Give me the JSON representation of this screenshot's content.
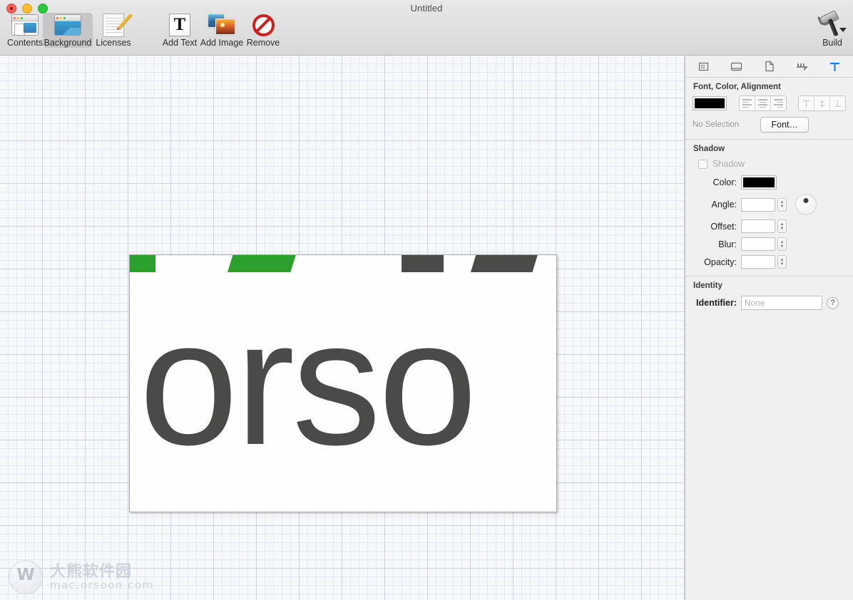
{
  "window": {
    "title": "Untitled",
    "traffic_lights": [
      "close",
      "minimize",
      "zoom"
    ]
  },
  "toolbar": {
    "items": [
      {
        "label": "Contents",
        "icon": "contents-window-icon",
        "selected": false
      },
      {
        "label": "Background",
        "icon": "background-window-icon",
        "selected": true
      },
      {
        "label": "Licenses",
        "icon": "licenses-document-icon",
        "selected": false
      },
      {
        "label": "Add Text",
        "icon": "add-text-t-icon",
        "selected": false
      },
      {
        "label": "Add Image",
        "icon": "add-image-photos-icon",
        "selected": false
      },
      {
        "label": "Remove",
        "icon": "remove-prohibited-icon",
        "selected": false
      }
    ],
    "build": {
      "label": "Build",
      "icon": "hammer-icon"
    }
  },
  "canvas": {
    "document_text": "orso",
    "text_color": "#4a4a48",
    "accent_green": "#2ba02f",
    "shapes": [
      {
        "name": "green-rect",
        "color": "#2ba02f"
      },
      {
        "name": "green-parallelogram",
        "color": "#2ba02f"
      },
      {
        "name": "dark-rect",
        "color": "#4a4a48"
      },
      {
        "name": "dark-parallelogram",
        "color": "#4a4a48"
      }
    ],
    "watermark": {
      "cn": "大熊软件园",
      "url": "mac.orsoon.com"
    }
  },
  "inspector": {
    "tabs": [
      {
        "name": "grid-tab",
        "glyph": "▦",
        "active": false
      },
      {
        "name": "window-tab",
        "glyph": "▭",
        "active": false
      },
      {
        "name": "document-tab",
        "glyph": "🗋",
        "active": false
      },
      {
        "name": "connections-tab",
        "glyph": "⚟",
        "active": false
      },
      {
        "name": "text-tab",
        "glyph": "T",
        "active": true
      }
    ],
    "font_section": {
      "title": "Font, Color, Alignment",
      "color_value": "#000000",
      "align_horizontal": [
        "align-left",
        "align-center",
        "align-right"
      ],
      "align_vertical": [
        "align-top",
        "align-middle",
        "align-bottom"
      ],
      "no_selection_label": "No Selection",
      "font_button": "Font…"
    },
    "shadow_section": {
      "title": "Shadow",
      "checkbox_label": "Shadow",
      "checkbox_checked": false,
      "fields": [
        {
          "label": "Color:",
          "type": "color",
          "value": "#000000"
        },
        {
          "label": "Angle:",
          "type": "number",
          "value": ""
        },
        {
          "label": "Offset:",
          "type": "number",
          "value": ""
        },
        {
          "label": "Blur:",
          "type": "number",
          "value": ""
        },
        {
          "label": "Opacity:",
          "type": "number",
          "value": ""
        }
      ]
    },
    "identity_section": {
      "title": "Identity",
      "identifier_label": "Identifier:",
      "identifier_value": "",
      "identifier_placeholder": "None",
      "help_label": "?"
    }
  }
}
